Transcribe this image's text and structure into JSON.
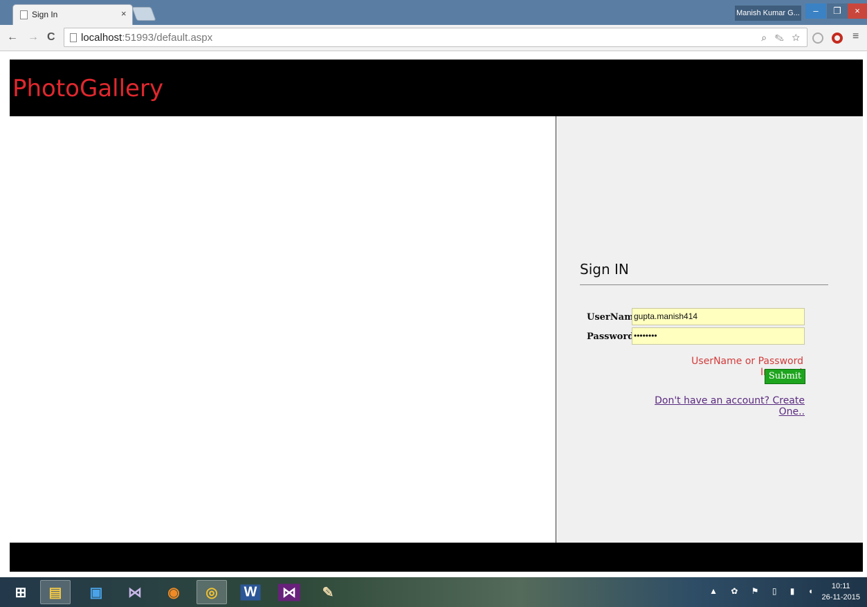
{
  "browser": {
    "tab_title": "Sign In",
    "tab_close": "×",
    "user_name": "Manish Kumar G...",
    "minimize": "–",
    "maximize": "❐",
    "close": "×",
    "back": "←",
    "forward": "→",
    "reload": "C",
    "url_host": "localhost",
    "url_rest": ":51993/default.aspx",
    "omnibox_icons": "⌕ ✎ ☆",
    "menu": "≡"
  },
  "page": {
    "brand": "PhotoGallery",
    "signin": {
      "title": "Sign IN",
      "username_label": "UserName",
      "username_value": "gupta.manish414",
      "password_label": "Password",
      "password_value": "••••••••",
      "error_message": "UserName or Password Incorrect",
      "submit_label": "Submit",
      "create_link": "Don't have an account? Create One.."
    }
  },
  "taskbar": {
    "items": [
      {
        "icon": "start-icon",
        "glyph": "⊞"
      },
      {
        "icon": "file-explorer-icon",
        "glyph": "▤"
      },
      {
        "icon": "outlook-icon",
        "glyph": "▣"
      },
      {
        "icon": "visual-studio-icon",
        "glyph": "⋈"
      },
      {
        "icon": "firefox-icon",
        "glyph": "◉"
      },
      {
        "icon": "chrome-icon",
        "glyph": "◎"
      },
      {
        "icon": "word-icon",
        "glyph": "W"
      },
      {
        "icon": "visual-studio-2-icon",
        "glyph": "⋈"
      },
      {
        "icon": "paint-icon",
        "glyph": "✎"
      }
    ],
    "tray_icons": "▲ ✿ ⚑ ▯ ▮ ◖",
    "time": "10:11",
    "date": "26-11-2015"
  },
  "colors": {
    "brand": "#e0282e",
    "error": "#d33b3b",
    "submit": "#1ea51e",
    "field_bg": "#ffffc0",
    "link": "#5a2a7f"
  }
}
